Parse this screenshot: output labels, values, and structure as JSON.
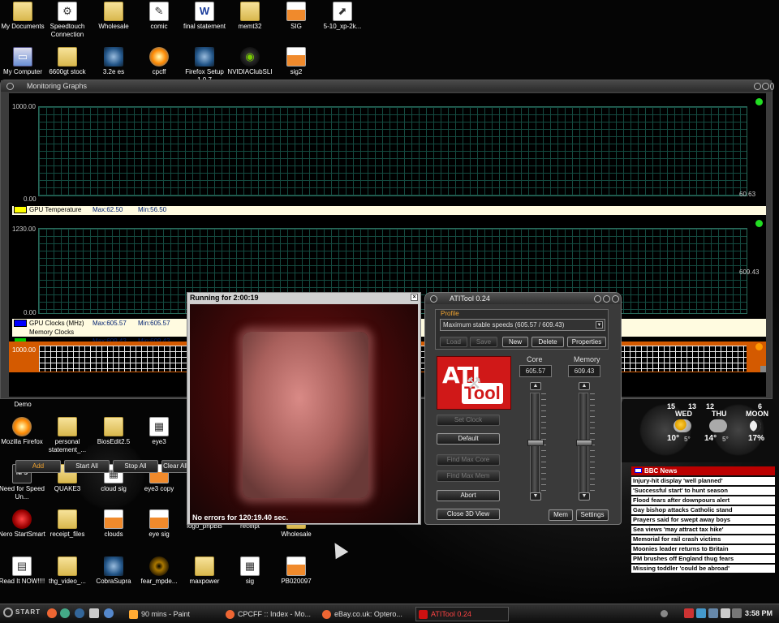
{
  "desktop": {
    "icons_top": [
      {
        "label": "My Documents",
        "kind": "folder"
      },
      {
        "label": "Speedtouch Connection",
        "kind": "app"
      },
      {
        "label": "Wholesale",
        "kind": "folder"
      },
      {
        "label": "comic",
        "kind": "doc"
      },
      {
        "label": "final statement",
        "kind": "word"
      },
      {
        "label": "memt32",
        "kind": "folder"
      },
      {
        "label": "SIG",
        "kind": "image"
      },
      {
        "label": "5-10_xp-2k...",
        "kind": "app"
      },
      {
        "label": "My Computer",
        "kind": "computer"
      },
      {
        "label": "6600gt stock",
        "kind": "folder"
      },
      {
        "label": "3.2e es",
        "kind": "app"
      },
      {
        "label": "cpcff",
        "kind": "firefox"
      },
      {
        "label": "Firefox Setup 1.0.7",
        "kind": "app"
      },
      {
        "label": "NVIDIAClubSLI",
        "kind": "app"
      },
      {
        "label": "sig2",
        "kind": "image"
      }
    ],
    "icons_bottom": [
      {
        "label": "Demo"
      },
      {
        "label": "Mozilla Firefox"
      },
      {
        "label": "personal statement_..."
      },
      {
        "label": "BiosEdit2.5"
      },
      {
        "label": "eye3"
      },
      {
        "label": "Need for Speed Un..."
      },
      {
        "label": "QUAKE3"
      },
      {
        "label": "cloud sig"
      },
      {
        "label": "eye3 copy"
      },
      {
        "label": "Nero StartSmart"
      },
      {
        "label": "receipt_files"
      },
      {
        "label": "clouds"
      },
      {
        "label": "eye sig"
      },
      {
        "label": "logo_phpBB"
      },
      {
        "label": "receipt"
      },
      {
        "label": "Wholesale"
      },
      {
        "label": "Read It NOW!!!!"
      },
      {
        "label": "thg_video_..."
      },
      {
        "label": "CobraSupra"
      },
      {
        "label": "fear_mpde..."
      },
      {
        "label": "maxpower"
      },
      {
        "label": "sig"
      },
      {
        "label": "PB020097"
      }
    ]
  },
  "monitor": {
    "title": "Monitoring Graphs",
    "graph1": {
      "ymax": "1000.00",
      "ymin": "0.00",
      "current": "60.63"
    },
    "temp_legend": {
      "name": "GPU Temperature",
      "max": "Max:62.50",
      "min": "Min:56.50"
    },
    "graph2": {
      "ymax": "1230.00",
      "ymin": "0.00",
      "current": "609.43"
    },
    "clock_legend": [
      {
        "name": "GPU Clocks (MHz)",
        "max": "Max:605.57",
        "min": "Min:605.57",
        "color": "#0000ff"
      },
      {
        "name": "Memory Clocks (MHz)",
        "max": "Max:609.43",
        "min": "Min:609.43",
        "color": "#00cc00"
      }
    ],
    "graph3": {
      "ymax": "1000.00"
    },
    "buttons": {
      "add": "Add",
      "start_all": "Start All",
      "stop_all": "Stop All",
      "clear_all": "Clear All"
    }
  },
  "ogl": {
    "title": "Running for 2:00:19",
    "status": "No errors for 120:19.40 sec."
  },
  "ati": {
    "title": "ATITool 0.24",
    "profile_label": "Profile",
    "profile_value": "Maximum stable speeds (605.57 / 609.43)",
    "buttons": {
      "load": "Load",
      "save": "Save",
      "new": "New",
      "delete": "Delete",
      "properties": "Properties"
    },
    "logo_ati": "ATI",
    "logo_tool": "Tool",
    "left_buttons": {
      "set_clock": "Set Clock",
      "default": "Default",
      "find_max_core": "Find Max Core",
      "find_max_mem": "Find Max Mem",
      "abort": "Abort",
      "close_3d": "Close 3D View"
    },
    "core_label": "Core",
    "memory_label": "Memory",
    "core_value": "605.57",
    "memory_value": "609.43",
    "core_level": 0.5,
    "memory_level": 0.5,
    "mem_button": "Mem",
    "settings_button": "Settings"
  },
  "weather": {
    "days": [
      {
        "num": "15",
        "name": "WED",
        "temp": "10°",
        "low": "5°"
      },
      {
        "num": "12",
        "name": "THU",
        "temp": "14°",
        "low": "5°"
      },
      {
        "num": "6",
        "name": "MOON",
        "temp": "17%"
      }
    ],
    "extra_num": "13"
  },
  "bbc": {
    "header": "BBC News",
    "items": [
      "Injury-hit display 'well planned'",
      "'Successful start' to hunt season",
      "Flood fears after downpours alert",
      "Gay bishop attacks Catholic stand",
      "Prayers said for swept away boys",
      "Sea views 'may attract tax hike'",
      "Memorial for rail crash victims",
      "Moonies leader returns to Britain",
      "PM brushes off England thug fears",
      "Missing toddler 'could be abroad'"
    ]
  },
  "taskbar": {
    "start": "START",
    "tasks": [
      "90 mins - Paint",
      "CPCFF :: Index - Mo...",
      "eBay.co.uk: Optero...",
      "ATITool 0.24"
    ],
    "clock": "3:58 PM"
  }
}
